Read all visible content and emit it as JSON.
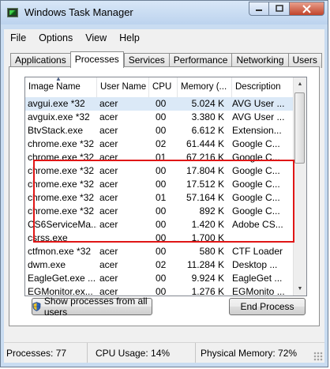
{
  "window": {
    "title": "Windows Task Manager"
  },
  "menu": [
    "File",
    "Options",
    "View",
    "Help"
  ],
  "tabs": [
    "Applications",
    "Processes",
    "Services",
    "Performance",
    "Networking",
    "Users"
  ],
  "active_tab": "Processes",
  "columns": [
    "Image Name",
    "User Name",
    "CPU",
    "Memory (...",
    "Description"
  ],
  "processes": [
    {
      "name": "avgui.exe *32",
      "user": "acer",
      "cpu": "00",
      "memory": "5.024 K",
      "description": "AVG User ..."
    },
    {
      "name": "avguix.exe *32",
      "user": "acer",
      "cpu": "00",
      "memory": "3.380 K",
      "description": "AVG User ..."
    },
    {
      "name": "BtvStack.exe",
      "user": "acer",
      "cpu": "00",
      "memory": "6.612 K",
      "description": "Extension..."
    },
    {
      "name": "chrome.exe *32",
      "user": "acer",
      "cpu": "02",
      "memory": "61.444 K",
      "description": "Google C..."
    },
    {
      "name": "chrome.exe *32",
      "user": "acer",
      "cpu": "01",
      "memory": "67.216 K",
      "description": "Google C..."
    },
    {
      "name": "chrome.exe *32",
      "user": "acer",
      "cpu": "00",
      "memory": "17.804 K",
      "description": "Google C..."
    },
    {
      "name": "chrome.exe *32",
      "user": "acer",
      "cpu": "00",
      "memory": "17.512 K",
      "description": "Google C..."
    },
    {
      "name": "chrome.exe *32",
      "user": "acer",
      "cpu": "01",
      "memory": "57.164 K",
      "description": "Google C..."
    },
    {
      "name": "chrome.exe *32",
      "user": "acer",
      "cpu": "00",
      "memory": "892 K",
      "description": "Google C..."
    },
    {
      "name": "CS6ServiceMa...",
      "user": "acer",
      "cpu": "00",
      "memory": "1.420 K",
      "description": "Adobe CS..."
    },
    {
      "name": "csrss.exe",
      "user": "",
      "cpu": "00",
      "memory": "1.700 K",
      "description": ""
    },
    {
      "name": "ctfmon.exe *32",
      "user": "acer",
      "cpu": "00",
      "memory": "580 K",
      "description": "CTF Loader"
    },
    {
      "name": "dwm.exe",
      "user": "acer",
      "cpu": "02",
      "memory": "11.284 K",
      "description": "Desktop ..."
    },
    {
      "name": "EagleGet.exe ...",
      "user": "acer",
      "cpu": "00",
      "memory": "9.924 K",
      "description": "EagleGet ..."
    },
    {
      "name": "EGMonitor.ex...",
      "user": "acer",
      "cpu": "00",
      "memory": "1.276 K",
      "description": "EGMonito ..."
    }
  ],
  "buttons": {
    "show_all": "Show processes from all users",
    "end_process": "End Process"
  },
  "status": {
    "processes": "Processes: 77",
    "cpu": "CPU Usage: 14%",
    "memory": "Physical Memory: 72%"
  },
  "colors": {
    "highlight_box": "#e01616",
    "selected_row": "#dbe9f7",
    "close_button": "#c1442a"
  },
  "icons": {
    "window": "task-manager-icon",
    "show_all_button": "uac-shield-icon"
  }
}
